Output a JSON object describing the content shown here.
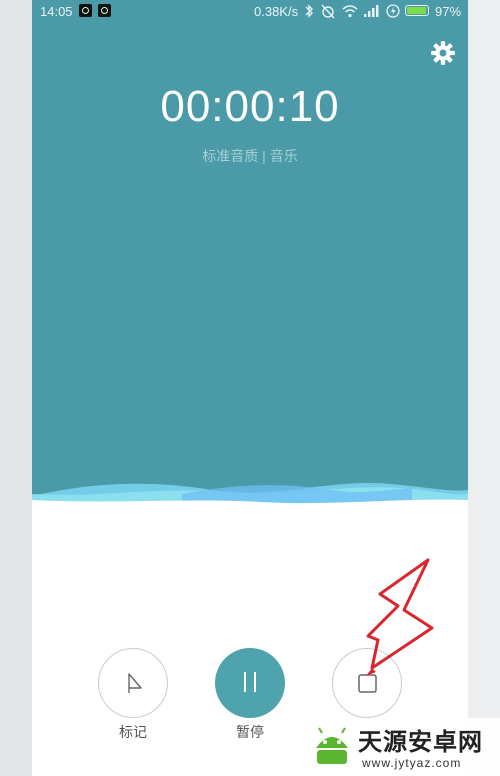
{
  "status_bar": {
    "time": "14:05",
    "net_speed": "0.38K/s",
    "battery_percent": "97%",
    "battery_level": 0.97,
    "icons": [
      "notification-app-icon",
      "notification-app-icon",
      "bluetooth-icon",
      "alarm-off-icon",
      "wifi-icon",
      "signal-icon",
      "charging-icon",
      "battery-icon"
    ]
  },
  "recorder": {
    "elapsed": "00:00:10",
    "quality_info": "标准音质 | 音乐"
  },
  "controls": {
    "mark_label": "标记",
    "pause_label": "暂停"
  },
  "watermark": {
    "title": "天源安卓网",
    "url": "www.jytyaz.com"
  },
  "colors": {
    "background_teal": "#4b9aa8",
    "pause_button": "#4fa3ad",
    "annotation_arrow": "#d9262e",
    "battery_fill": "#7ddc4a",
    "logo_green": "#5cb531"
  }
}
